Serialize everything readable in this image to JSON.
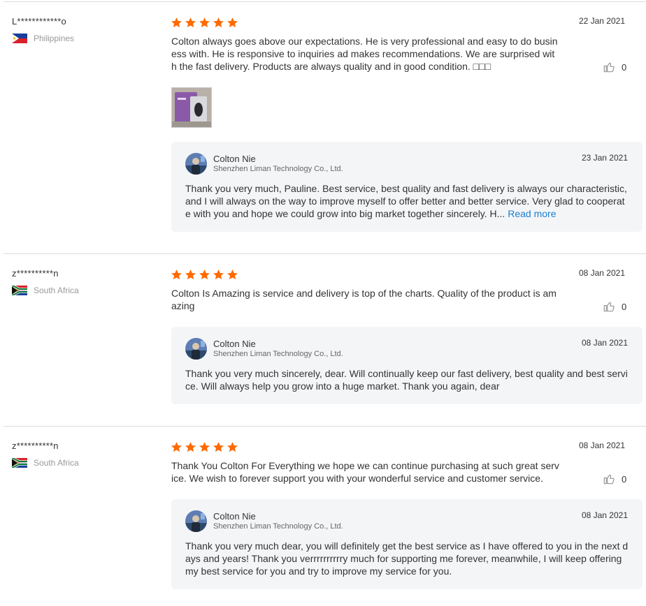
{
  "reviews": [
    {
      "buyer": "L************o",
      "country": "Philippines",
      "flag": "philippines",
      "rating": 5,
      "date": "22 Jan 2021",
      "text": "Colton always goes above our expectations. He is very professional and easy to do business with.  He is  responsive to inquiries ad makes recommendations. We are surprised with the fast delivery. Products are always quality and in good condition.  □□□",
      "likes": "0",
      "photo": "purple product box with mouse",
      "reply": {
        "seller": "Colton Nie",
        "company": "Shenzhen Liman Technology Co., Ltd.",
        "date": "23 Jan 2021",
        "text": "Thank you very much, Pauline. Best service, best quality and fast delivery is always our characteristic, and I will always on the way to improve myself to offer better and better service. Very glad to cooperate with you and hope we could grow into big market together sincerely. H...",
        "read_more": "Read more"
      }
    },
    {
      "buyer": "z**********n",
      "country": "South Africa",
      "flag": "south-africa",
      "rating": 5,
      "date": "08 Jan 2021",
      "text": "Colton Is Amazing is service and delivery is top of the charts. Quality of the product is amazing",
      "likes": "0",
      "reply": {
        "seller": "Colton Nie",
        "company": "Shenzhen Liman Technology Co., Ltd.",
        "date": "08 Jan 2021",
        "text": "Thank you very much sincerely, dear. Will continually keep our fast delivery, best quality and best service. Will always help you grow into a huge market.  Thank you again, dear"
      }
    },
    {
      "buyer": "z**********n",
      "country": "South Africa",
      "flag": "south-africa",
      "rating": 5,
      "date": "08 Jan 2021",
      "text": "Thank You Colton For Everything we hope we can continue purchasing at such great service. We wish to forever support you with your wonderful service and customer service.",
      "likes": "0",
      "reply": {
        "seller": "Colton Nie",
        "company": "Shenzhen Liman Technology Co., Ltd.",
        "date": "08 Jan 2021",
        "text": "Thank you very much dear, you will definitely get the best service as I have offered to you in the next days and years! Thank you verrrrrrrrrry much for supporting me forever, meanwhile, I will keep offering my best service for you and try to improve my service for you."
      }
    }
  ],
  "colors": {
    "star": "#ff6a00",
    "link": "#1a7fd4",
    "reply_bg": "#f4f5f7"
  },
  "icons": {
    "star": "star-icon",
    "like": "thumbs-up-icon"
  }
}
